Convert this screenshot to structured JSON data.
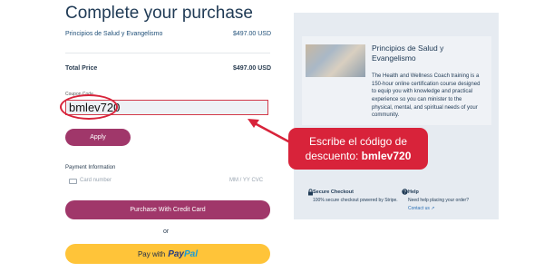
{
  "header": {
    "title": "Complete your purchase"
  },
  "order": {
    "item_name": "Principios de Salud y Evangelismo",
    "item_price": "$497.00 USD",
    "total_label": "Total Price",
    "total_value": "$497.00 USD"
  },
  "coupon": {
    "label": "Coupon Code",
    "value": "bmlev720",
    "apply_label": "Apply"
  },
  "payment": {
    "section_label": "Payment Information",
    "card_placeholder": "Card number",
    "expiry_placeholder": "MM / YY  CVC",
    "purchase_label": "Purchase With Credit Card",
    "or_label": "or",
    "paypal_prefix": "Pay with",
    "paypal_logo_a": "Pay",
    "paypal_logo_b": "Pal"
  },
  "summary": {
    "course_title": "Principios de Salud y Evangelismo",
    "course_desc": "The Health and Wellness Coach training is a 150-hour online certification course designed to equip you with knowledge and practical experience so you can minister to the physical, mental, and spiritual needs of your community.",
    "secure_title": "Secure Checkout",
    "secure_text": "100% secure checkout powered by Stripe.",
    "help_title": "Help",
    "help_text": "Need help placing your order?",
    "contact_link": "Contact us"
  },
  "annotation": {
    "line1": "Escribe el código de",
    "line2_prefix": "descuento: ",
    "line2_code": "bmlev720",
    "color": "#d8233a"
  },
  "colors": {
    "primary_button": "#a0376a",
    "paypal_button": "#ffc439",
    "panel_bg": "#e6ebf1",
    "title_text": "#1f3a55"
  }
}
